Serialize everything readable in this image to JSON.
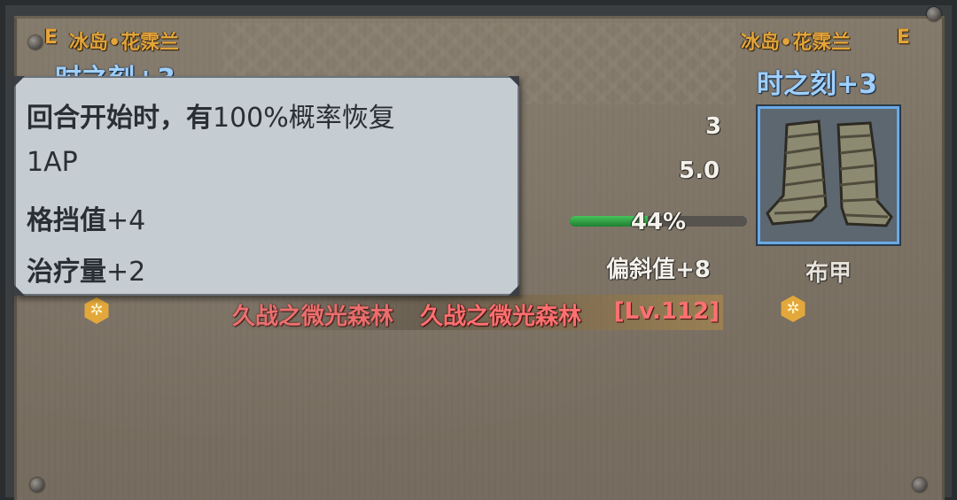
{
  "left_item": {
    "slot_letter": "E",
    "owner_name": "冰岛•花霂兰",
    "enchant": "时之刻+3"
  },
  "right_item": {
    "owner_name": "冰岛•花霂兰",
    "slot_letter": "E",
    "enchant": "时之刻+3",
    "icon": "cloth-boots-icon",
    "item_type": "布甲"
  },
  "stats": {
    "value_1": "3",
    "value_2": "5.0",
    "durability_label": "44%",
    "durability_fraction": 0.44,
    "deflect": "偏斜值+8"
  },
  "set_bonus": {
    "name_faded": "久战之微光森林",
    "name": "久战之微光森林",
    "level": "[Lv.112]"
  },
  "tooltip": {
    "line_1_bold": "回合开始时，有",
    "line_1_rest": "100%概率恢复",
    "line_2": "1AP",
    "line_3_bold": "格挡值",
    "line_3_rest": "+4",
    "line_4_bold": "治疗量",
    "line_4_rest": "+2"
  },
  "colors": {
    "header_gold": "#e3a43a",
    "enchant_blue": "#9fd0ff",
    "set_red": "#ff7070",
    "item_border_blue": "#6aa9e6",
    "bar_green": "#47c35c"
  }
}
